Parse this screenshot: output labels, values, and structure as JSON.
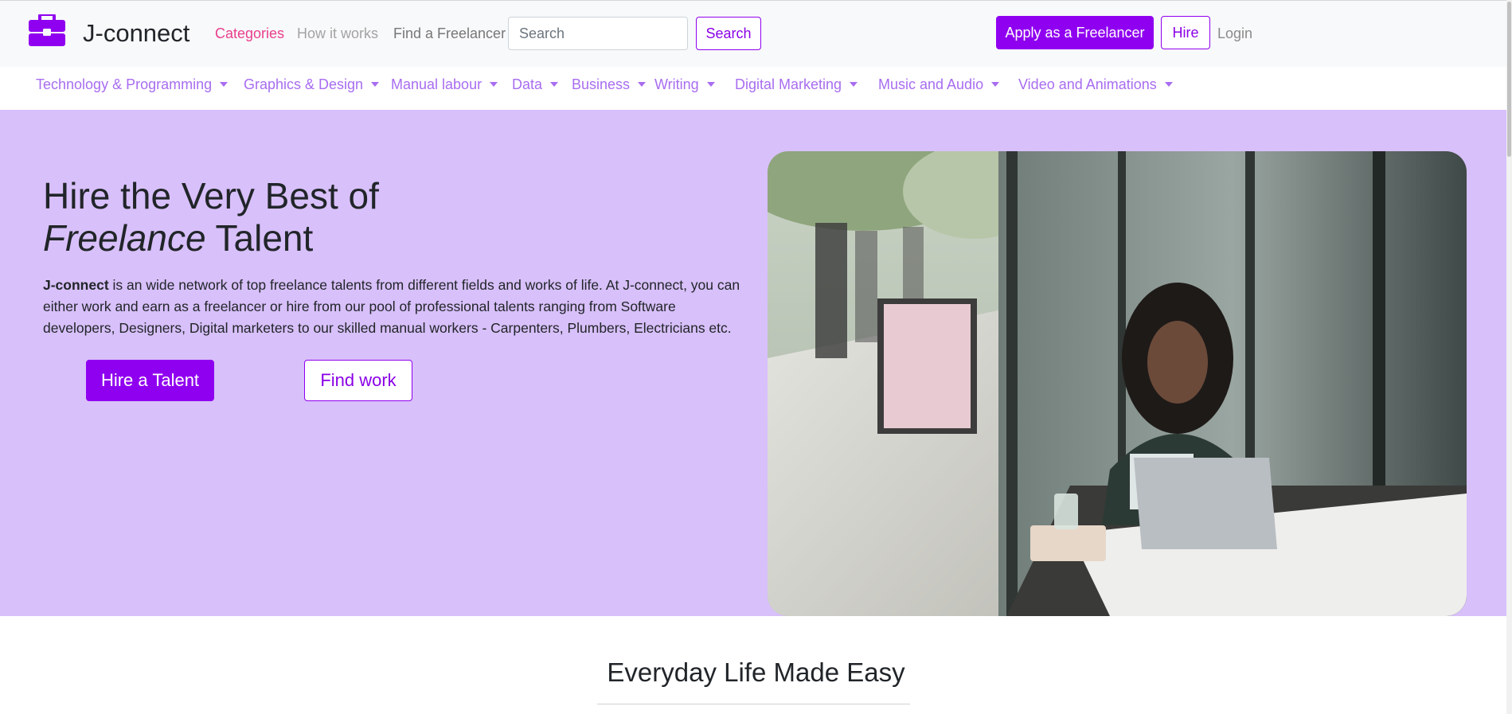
{
  "header": {
    "brand": "J-connect",
    "nav": {
      "categories": "Categories",
      "how_it_works": "How it works",
      "find_freelancer": "Find a Freelancer"
    },
    "search": {
      "placeholder": "Search",
      "button": "Search"
    },
    "apply_button": "Apply as a Freelancer",
    "hire_button": "Hire",
    "login": "Login"
  },
  "categories": [
    "Technology & Programming",
    "Graphics & Design",
    "Manual labour",
    "Data",
    "Business",
    "Writing",
    "Digital Marketing",
    "Music and Audio",
    "Video and Animations"
  ],
  "hero": {
    "title_line1": "Hire the Very Best of",
    "title_italic": "Freelance",
    "title_rest": " Talent",
    "desc_brand": "J-connect",
    "desc_text": " is an wide network of top freelance talents from different fields and works of life. At J-connect, you can either work and earn as a freelancer or hire from our pool of professional talents ranging from Software developers, Designers, Digital marketers to our skilled manual workers - Carpenters, Plumbers, Electricians etc.",
    "hire_talent_button": "Hire a Talent",
    "find_work_button": "Find work"
  },
  "section": {
    "title": "Everyday Life Made Easy"
  },
  "colors": {
    "accent": "#9000f0",
    "hero_bg": "#d8c0fa",
    "category_text": "#a86df0",
    "active_nav": "#e83e8c"
  }
}
